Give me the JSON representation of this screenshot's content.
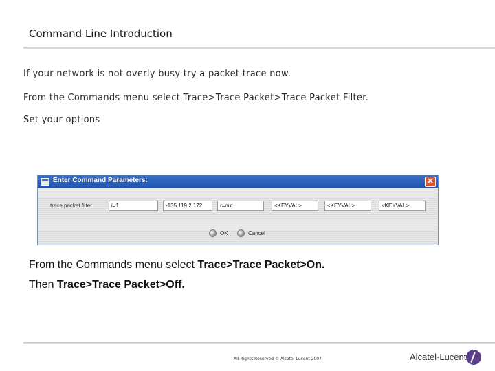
{
  "slide": {
    "title": "Command Line Introduction",
    "line1": "If your network is not overly busy try a packet trace now.",
    "line2": "From the Commands menu select Trace>Trace Packet>Trace Packet Filter.",
    "line3": "Set your options"
  },
  "dialog": {
    "title": "Enter Command Parameters:",
    "close_symbol": "✕",
    "param_label": "trace packet filter",
    "fields": [
      "i=1",
      "-135.119.2.172",
      "r=out",
      "<KEYVAL>",
      "<KEYVAL>",
      "<KEYVAL>"
    ],
    "ok_label": "OK",
    "cancel_label": "Cancel"
  },
  "caption": {
    "line1_prefix": "From the Commands menu select ",
    "line1_bold": "Trace>Trace Packet>On.",
    "line2_prefix": "Then ",
    "line2_bold": "Trace>Trace Packet>Off."
  },
  "footer": {
    "copyright": "All Rights Reserved © Alcatel-Lucent 2007",
    "logo_text": "Alcatel·Lucent"
  },
  "colors": {
    "titlebar": "#1f55b0",
    "close": "#d8593a",
    "logo": "#5b3f8a"
  }
}
